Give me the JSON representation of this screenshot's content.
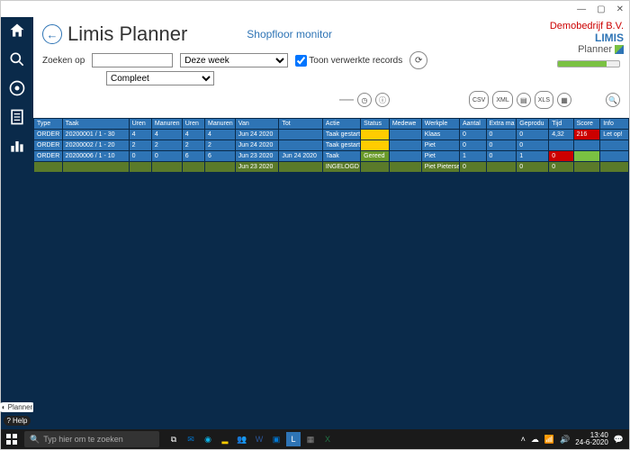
{
  "window": {
    "min": "—",
    "max": "▢",
    "close": "✕"
  },
  "brand": {
    "company": "Demobedrijf B.V.",
    "logo": "LIMIS",
    "product": "Planner"
  },
  "header": {
    "title": "Limis Planner",
    "monitor": "Shopfloor monitor",
    "search_label": "Zoeken op",
    "search_value": "",
    "period_options": [
      "Deze week"
    ],
    "period_value": "Deze week",
    "status_options": [
      "Compleet"
    ],
    "status_value": "Compleet",
    "show_processed": "Toon verwerkte records",
    "record_count": "4"
  },
  "toolbar": {
    "csv": "CSV",
    "xml": "XML",
    "file": "▤",
    "xls": "XLS",
    "doc": "▦",
    "search": "🔍",
    "refresh": "⟳",
    "clock": "◷",
    "dash": "—",
    "info": "ⓘ"
  },
  "sidebar": {
    "planner_label": "Planner",
    "help_label": "Help"
  },
  "columns": [
    "Type",
    "Taak",
    "Uren",
    "Manuren",
    "Uren",
    "Manuren",
    "Van",
    "Tot",
    "Actie",
    "Status",
    "Medewe",
    "Werkple",
    "Aantal",
    "Extra ma",
    "Geprodu",
    "Tijd",
    "Score",
    "Info"
  ],
  "rows": [
    {
      "cells": [
        "ORDER",
        "20200001 / 1 - 30",
        "4",
        "4",
        "4",
        "4",
        "Jun 24 2020",
        "",
        "Taak gestart",
        "",
        "",
        "Klaas",
        "0",
        "0",
        "0",
        "4,32",
        "216",
        "Let op!"
      ],
      "status_class": "y",
      "score_class": "r",
      "tijd_class": ""
    },
    {
      "cells": [
        "ORDER",
        "20200002 / 1 - 20",
        "2",
        "2",
        "2",
        "2",
        "Jun 24 2020",
        "",
        "Taak gestart",
        "",
        "",
        "Piet",
        "0",
        "0",
        "0",
        "",
        "",
        ""
      ],
      "status_class": "y",
      "score_class": "",
      "tijd_class": ""
    },
    {
      "cells": [
        "ORDER",
        "20200006 / 1 - 10",
        "0",
        "0",
        "6",
        "6",
        "Jun 23 2020",
        "Jun 24 2020",
        "Taak",
        "Gereed",
        "",
        "Piet",
        "1",
        "0",
        "1",
        "0",
        "",
        ""
      ],
      "status_class": "",
      "score_class": "lime",
      "tijd_class": "r",
      "gereed": true
    },
    {
      "summary": true,
      "cells": [
        "",
        "",
        "",
        "",
        "",
        "",
        "Jun 23 2020",
        "",
        "INGELOGD",
        "",
        "",
        "Piet Pieterse",
        "0",
        "",
        "0",
        "0",
        "",
        ""
      ]
    }
  ],
  "taskbar": {
    "search_placeholder": "Typ hier om te zoeken",
    "time": "13:40",
    "date": "24-6-2020"
  }
}
